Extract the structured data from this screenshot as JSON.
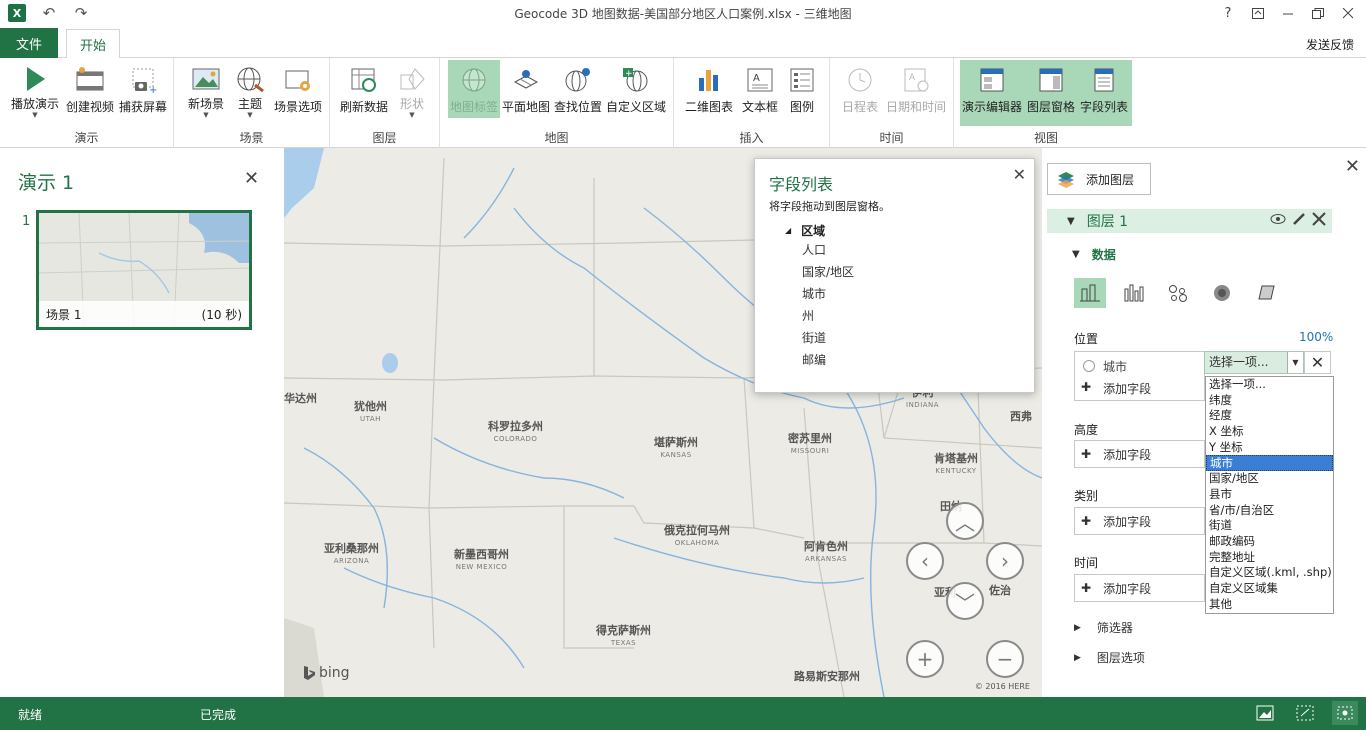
{
  "window": {
    "title": "Geocode 3D 地图数据-美国部分地区人口案例.xlsx - 三维地图",
    "help": "?"
  },
  "tabs": {
    "file": "文件",
    "home": "开始",
    "feedback": "发送反馈"
  },
  "ribbon": {
    "groups": {
      "tour": "演示",
      "scene": "场景",
      "layer": "图层",
      "map": "地图",
      "insert": "插入",
      "time": "时间",
      "view": "视图"
    },
    "buttons": {
      "play_tour": "播放演示",
      "create_video": "创建视频",
      "capture_screen": "捕获屏幕",
      "new_scene": "新场景",
      "themes": "主题",
      "scene_options": "场景选项",
      "refresh_data": "刷新数据",
      "shapes": "形状",
      "map_labels": "地图标签",
      "flat_map": "平面地图",
      "find_location": "查找位置",
      "custom_regions": "自定义区域",
      "2d_chart": "二维图表",
      "text_box": "文本框",
      "legend": "图例",
      "timeline": "日程表",
      "date_time": "日期和时间",
      "tour_editor": "演示编辑器",
      "layer_pane": "图层窗格",
      "field_list": "字段列表"
    }
  },
  "tour_panel": {
    "title": "演示 1",
    "scene_number": "1",
    "scene_name": "场景 1",
    "scene_duration": "(10 秒)"
  },
  "map": {
    "labels": [
      {
        "cn": "犹他州",
        "en": "UTAH"
      },
      {
        "cn": "科罗拉多州",
        "en": "COLORADO"
      },
      {
        "cn": "堪萨斯州",
        "en": "KANSAS"
      },
      {
        "cn": "密苏里州",
        "en": "MISSOURI"
      },
      {
        "cn": "肯塔基州",
        "en": "KENTUCKY"
      },
      {
        "cn": "亚利桑那州",
        "en": "ARIZONA"
      },
      {
        "cn": "新墨西哥州",
        "en": "NEW MEXICO"
      },
      {
        "cn": "俄克拉何马州",
        "en": "OKLAHOMA"
      },
      {
        "cn": "阿肯色州",
        "en": "ARKANSAS"
      },
      {
        "cn": "得克萨斯州",
        "en": "TEXAS"
      },
      {
        "cn": "路易斯安那州",
        "en": ""
      },
      {
        "cn": "亚利",
        "en": ""
      },
      {
        "cn": "佐治",
        "en": ""
      },
      {
        "cn": "田纳",
        "en": ""
      },
      {
        "cn": "西弗",
        "en": ""
      },
      {
        "cn": "华达州",
        "en": ""
      },
      {
        "cn": "伊利",
        "en": "INDIANA"
      }
    ],
    "bing": "bing",
    "copyright": "© 2016 HERE"
  },
  "field_list": {
    "title": "字段列表",
    "subtitle": "将字段拖动到图层窗格。",
    "group": "区域",
    "fields": [
      "人口",
      "国家/地区",
      "城市",
      "州",
      "街道",
      "邮编"
    ]
  },
  "layer_pane": {
    "add_layer": "添加图层",
    "layer_name": "图层 1",
    "data_section": "数据",
    "location_label": "位置",
    "percent": "100%",
    "location_field": "城市",
    "combo_value": "选择一项...",
    "add_field": "添加字段",
    "height_label": "高度",
    "category_label": "类别",
    "time_label": "时间",
    "filters": "筛选器",
    "layer_options": "图层选项",
    "dropdown_options": [
      "选择一项...",
      "纬度",
      "经度",
      "X 坐标",
      "Y 坐标",
      "城市",
      "国家/地区",
      "县市",
      "省/市/自治区",
      "街道",
      "邮政编码",
      "完整地址",
      "自定义区域(.kml, .shp)",
      "自定义区域集",
      "其他"
    ],
    "dropdown_selected": "城市"
  },
  "status": {
    "ready": "就绪",
    "done": "已完成"
  },
  "colors": {
    "accent": "#217346",
    "selected": "#a9d8b8",
    "dropdown_highlight": "#3a7fd4"
  }
}
